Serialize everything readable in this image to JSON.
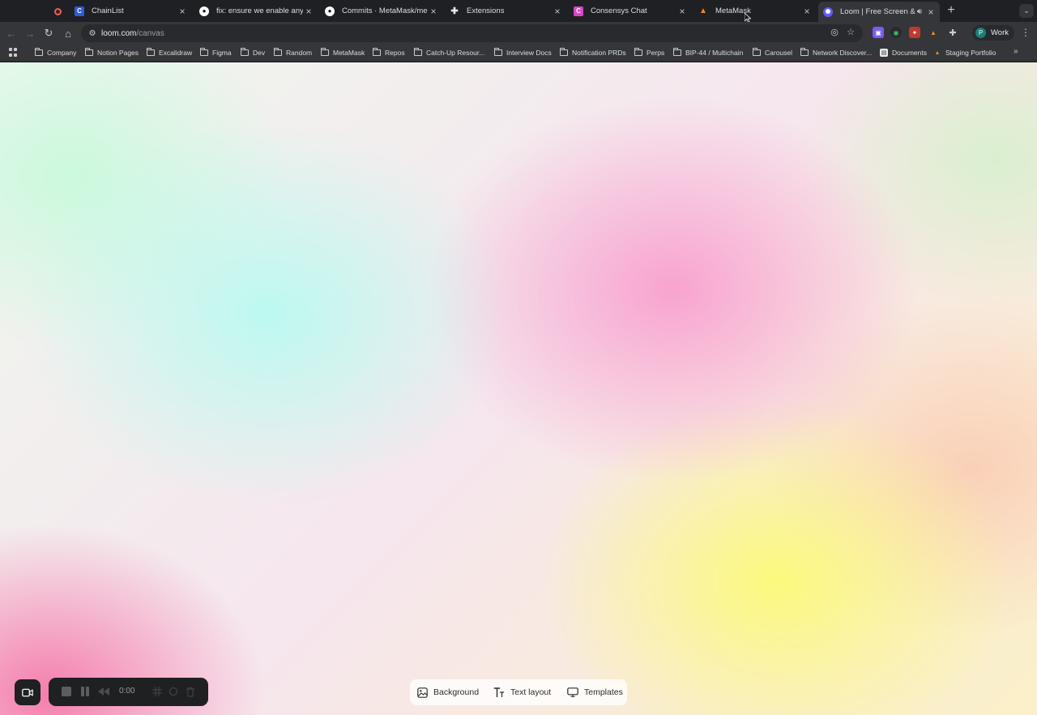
{
  "tabs": [
    {
      "title": "ChainList",
      "favicon": "chainlist-icon",
      "color": "#2b5cd9",
      "glyph": "C",
      "x": 0
    },
    {
      "title": "fix: ensure we enable any missing",
      "favicon": "github-icon",
      "color": "#ffffff",
      "glyph": "",
      "x": 1
    },
    {
      "title": "Commits · MetaMask/metamask",
      "favicon": "github-icon",
      "color": "#ffffff",
      "glyph": "",
      "x": 2
    },
    {
      "title": "Extensions",
      "favicon": "puzzle-icon",
      "color": "#e8eaed",
      "glyph": "✚",
      "x": 3
    },
    {
      "title": "Consensys Chat",
      "favicon": "consensys-chat-icon",
      "color": "#d946c8",
      "glyph": "C",
      "x": 4
    },
    {
      "title": "MetaMask",
      "favicon": "metamask-fox-icon",
      "color": "#f6851b",
      "glyph": "▲",
      "x": 5
    },
    {
      "title": "Loom | Free Screen & Video Recording",
      "favicon": "loom-icon",
      "color": "#625df5",
      "glyph": "✺",
      "x": 6,
      "active": true
    }
  ],
  "address": {
    "host": "loom.com",
    "path": "/canvas"
  },
  "profile": {
    "initial": "P",
    "label": "Work"
  },
  "bookmarks": [
    {
      "label": "Company",
      "type": "folder"
    },
    {
      "label": "Notion Pages",
      "type": "folder"
    },
    {
      "label": "Excalidraw",
      "type": "folder"
    },
    {
      "label": "Figma",
      "type": "folder"
    },
    {
      "label": "Dev",
      "type": "folder"
    },
    {
      "label": "Random",
      "type": "folder"
    },
    {
      "label": "MetaMask",
      "type": "folder"
    },
    {
      "label": "Repos",
      "type": "folder"
    },
    {
      "label": "Catch-Up Resour...",
      "type": "folder"
    },
    {
      "label": "Interview Docs",
      "type": "folder"
    },
    {
      "label": "Notification PRDs",
      "type": "folder"
    },
    {
      "label": "Perps",
      "type": "folder"
    },
    {
      "label": "BIP-44 / Multichain",
      "type": "folder"
    },
    {
      "label": "Carousel",
      "type": "folder"
    },
    {
      "label": "Network Discover...",
      "type": "folder"
    },
    {
      "label": "Documents",
      "type": "page"
    },
    {
      "label": "Staging Portfolio",
      "type": "fox"
    }
  ],
  "recorder": {
    "time": "0:00"
  },
  "canvas_tools": {
    "background_label": "Background",
    "text_layout_label": "Text layout",
    "templates_label": "Templates"
  }
}
